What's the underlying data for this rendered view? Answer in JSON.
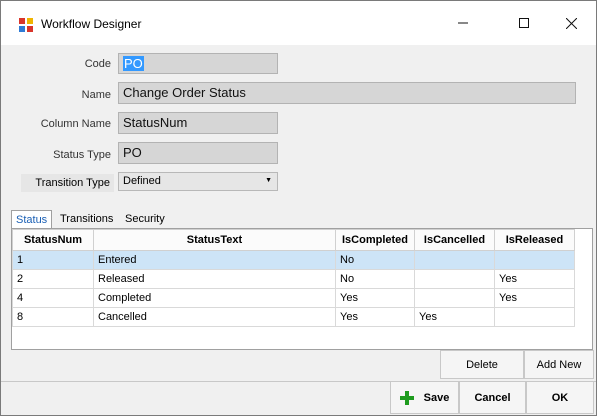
{
  "window": {
    "title": "Workflow Designer"
  },
  "form": {
    "code_label": "Code",
    "code_value": "PO",
    "name_label": "Name",
    "name_value": "Change Order Status",
    "column_label": "Column Name",
    "column_value": "StatusNum",
    "status_type_label": "Status Type",
    "status_type_value": "PO",
    "transition_label": "Transition Type",
    "transition_value": "Defined"
  },
  "tabs": [
    "Status",
    "Transitions",
    "Security"
  ],
  "grid": {
    "columns": [
      "StatusNum",
      "StatusText",
      "IsCompleted",
      "IsCancelled",
      "IsReleased"
    ],
    "rows": [
      [
        "1",
        "Entered",
        "No",
        "",
        ""
      ],
      [
        "2",
        "Released",
        "No",
        "",
        "Yes"
      ],
      [
        "4",
        "Completed",
        "Yes",
        "",
        "Yes"
      ],
      [
        "8",
        "Cancelled",
        "Yes",
        "Yes",
        ""
      ]
    ]
  },
  "buttons": {
    "delete": "Delete",
    "add_new": "Add New",
    "save": "Save",
    "cancel": "Cancel",
    "ok": "OK"
  },
  "icons": {
    "app": "workflow-app-icon",
    "save": "plus-icon",
    "min": "minimize-icon",
    "max": "maximize-icon",
    "close": "close-icon"
  },
  "colors": {
    "accent": "#3399ff",
    "selected_row": "#cde4f7",
    "save_plus": "#1e9b1e"
  }
}
